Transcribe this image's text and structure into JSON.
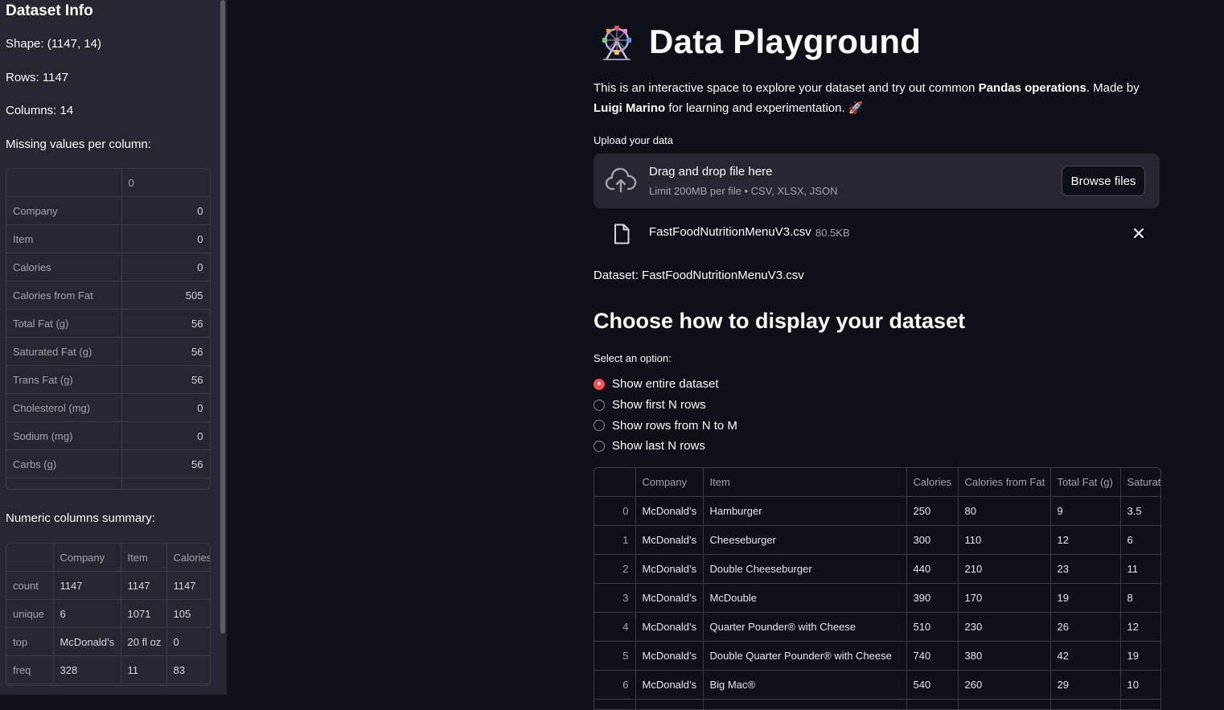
{
  "sidebar": {
    "title": "Dataset Info",
    "shape": "Shape: (1147, 14)",
    "rows": "Rows: 1147",
    "columns": "Columns: 14",
    "missing_heading": "Missing values per column:",
    "missing_table": {
      "header": "0",
      "rows": [
        {
          "name": "Company",
          "value": "0"
        },
        {
          "name": "Item",
          "value": "0"
        },
        {
          "name": "Calories",
          "value": "0"
        },
        {
          "name": "Calories from Fat",
          "value": "505"
        },
        {
          "name": "Total Fat (g)",
          "value": "56"
        },
        {
          "name": "Saturated Fat (g)",
          "value": "56"
        },
        {
          "name": "Trans Fat (g)",
          "value": "56"
        },
        {
          "name": "Cholesterol (mg)",
          "value": "0"
        },
        {
          "name": "Sodium  (mg)",
          "value": "0"
        },
        {
          "name": "Carbs (g)",
          "value": "56"
        }
      ]
    },
    "summary_heading": "Numeric columns summary:",
    "summary_table": {
      "headers": [
        "",
        "Company",
        "Item",
        "Calories"
      ],
      "rows": [
        [
          "count",
          "1147",
          "1147",
          "1147"
        ],
        [
          "unique",
          "6",
          "1071",
          "105"
        ],
        [
          "top",
          "McDonald’s",
          "20 fl oz",
          "0"
        ],
        [
          "freq",
          "328",
          "11",
          "83"
        ]
      ]
    }
  },
  "main": {
    "title": "Data Playground",
    "intro": {
      "p1": "This is an interactive space to explore your dataset and try out common ",
      "b1": "Pandas operations",
      "p2": ". Made by ",
      "b2": "Luigi Marino",
      "p3": " for learning and experimentation. 🚀"
    },
    "upload_label": "Upload your data",
    "uploader": {
      "main_text": "Drag and drop file here",
      "sub_text": "Limit 200MB per file • CSV, XLSX, JSON",
      "browse_label": "Browse files"
    },
    "file": {
      "name": "FastFoodNutritionMenuV3.csv",
      "size": "80.5KB"
    },
    "dataset_line": "Dataset: FastFoodNutritionMenuV3.csv",
    "section_heading": "Choose how to display your dataset",
    "radio_label": "Select an option:",
    "radio_options": [
      {
        "label": "Show entire dataset",
        "selected": true
      },
      {
        "label": "Show first N rows",
        "selected": false
      },
      {
        "label": "Show rows from N to M",
        "selected": false
      },
      {
        "label": "Show last N rows",
        "selected": false
      }
    ],
    "table": {
      "headers": [
        "",
        "Company",
        "Item",
        "Calories",
        "Calories from Fat",
        "Total Fat (g)",
        "Saturated Fat (g)"
      ],
      "rows": [
        [
          "0",
          "McDonald’s",
          "Hamburger",
          "250",
          "80",
          "9",
          "3.5"
        ],
        [
          "1",
          "McDonald’s",
          "Cheeseburger",
          "300",
          "110",
          "12",
          "6"
        ],
        [
          "2",
          "McDonald’s",
          "Double Cheeseburger",
          "440",
          "210",
          "23",
          "11"
        ],
        [
          "3",
          "McDonald’s",
          "McDouble",
          "390",
          "170",
          "19",
          "8"
        ],
        [
          "4",
          "McDonald’s",
          " Quarter Pounder® with Cheese",
          "510",
          "230",
          "26",
          "12"
        ],
        [
          "5",
          "McDonald’s",
          "Double Quarter Pounder® with Cheese",
          "740",
          "380",
          "42",
          "19"
        ],
        [
          "6",
          "McDonald’s",
          "Big Mac®",
          "540",
          "260",
          "29",
          "10"
        ],
        [
          "7",
          "",
          "",
          "",
          "",
          "",
          ""
        ]
      ]
    }
  },
  "colors": {
    "bg": "#0e1117",
    "sidebar": "#262730",
    "accent": "#ff4b4b"
  },
  "icons": {
    "app": "ferris-wheel-icon",
    "upload": "cloud-upload-icon",
    "file": "file-icon",
    "close": "close-icon"
  }
}
